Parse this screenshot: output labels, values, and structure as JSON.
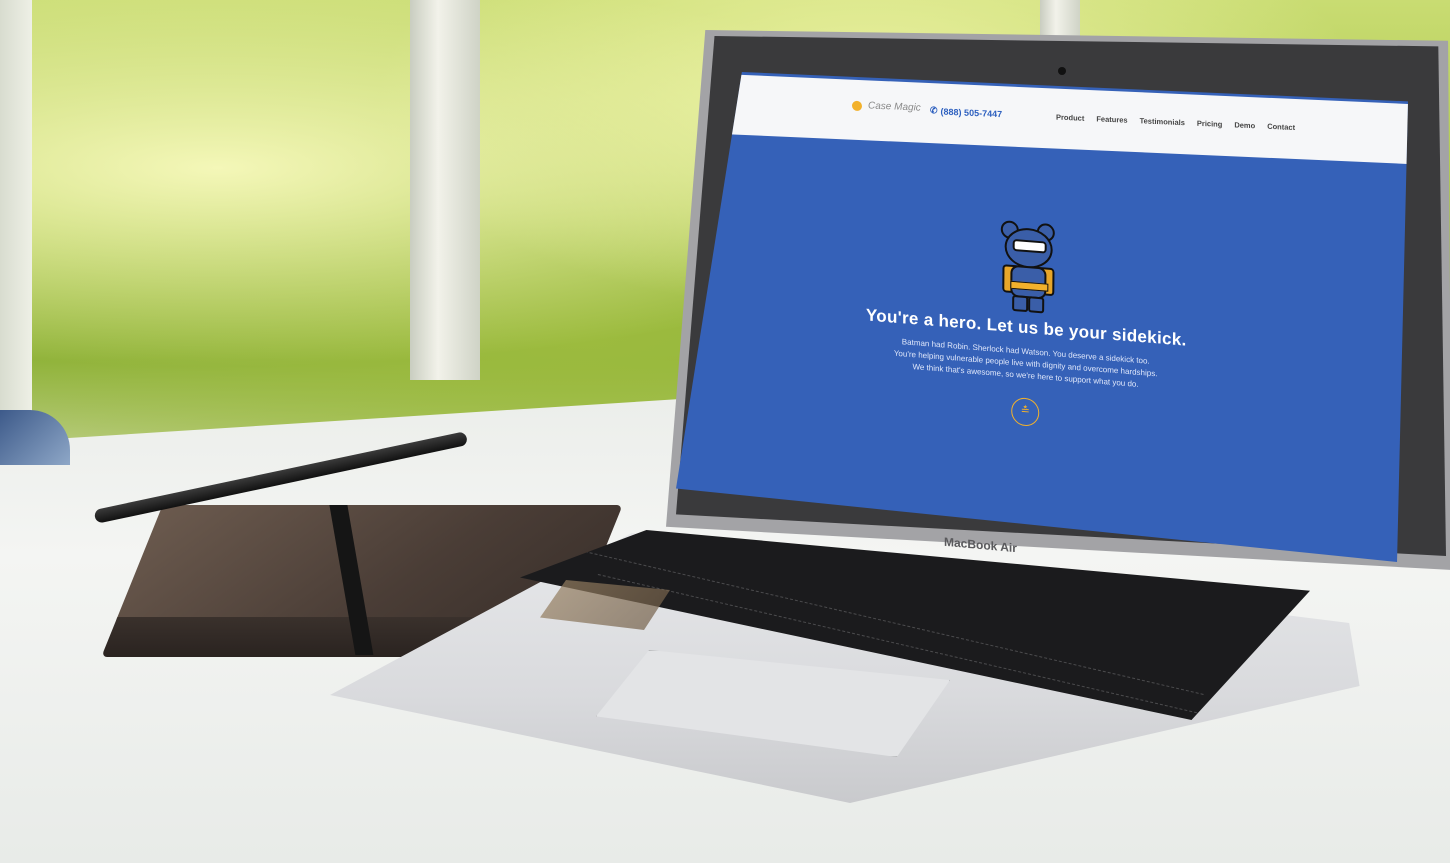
{
  "device": {
    "model_label": "MacBook Air"
  },
  "website": {
    "brand": "Case Magic",
    "phone": "(888) 505-7447",
    "nav": [
      "Product",
      "Features",
      "Testimonials",
      "Pricing",
      "Demo",
      "Contact"
    ],
    "hero_title": "You're a hero. Let us be your sidekick.",
    "hero_lines": [
      "Batman had Robin. Sherlock had Watson. You deserve a sidekick too.",
      "You're helping vulnerable people live with dignity and overcome hardships.",
      "We think that's awesome, so we're here to support what you do."
    ],
    "scroll_icon": "chevron-double-down-icon",
    "colors": {
      "hero_bg": "#3561b8",
      "accent": "#f2b12c",
      "nav_bg": "#f6f7f9"
    }
  }
}
